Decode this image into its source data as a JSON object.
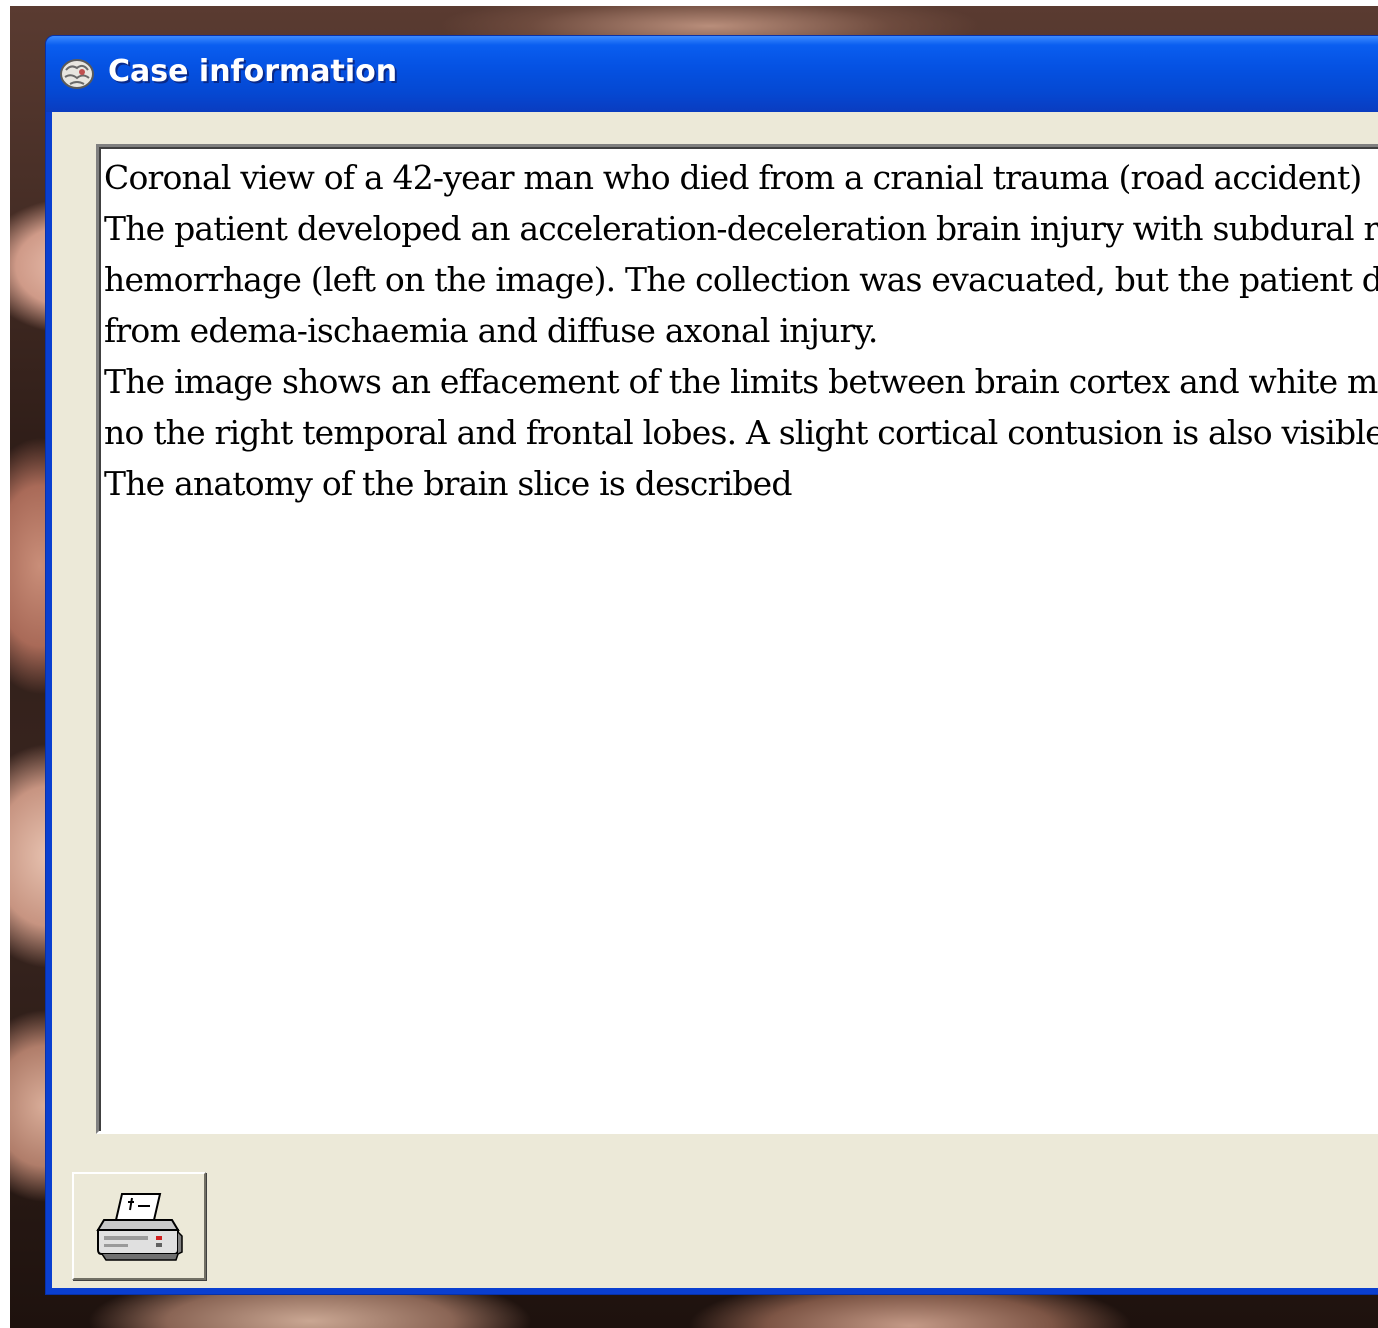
{
  "window": {
    "title": "Case information",
    "title_icon": "brain-app-icon"
  },
  "case_text": {
    "lines": [
      "Coronal view of a 42-year man who died from a cranial trauma (road accident)",
      "The patient developed an acceleration-deceleration brain injury with subdural ri",
      "hemorrhage (left on the image). The collection was evacuated, but the patient d",
      "from edema-ischaemia and diffuse axonal injury.",
      "The image shows an effacement of the limits between brain cortex and white ma",
      "no the right temporal and frontal lobes. A slight cortical contusion is also visible.",
      "The anatomy of the brain slice is described"
    ]
  },
  "toolbar": {
    "print_icon": "printer-icon"
  },
  "colors": {
    "titlebar": "#0552e3",
    "client_background": "#ece9d8",
    "text_area_background": "#ffffff"
  }
}
